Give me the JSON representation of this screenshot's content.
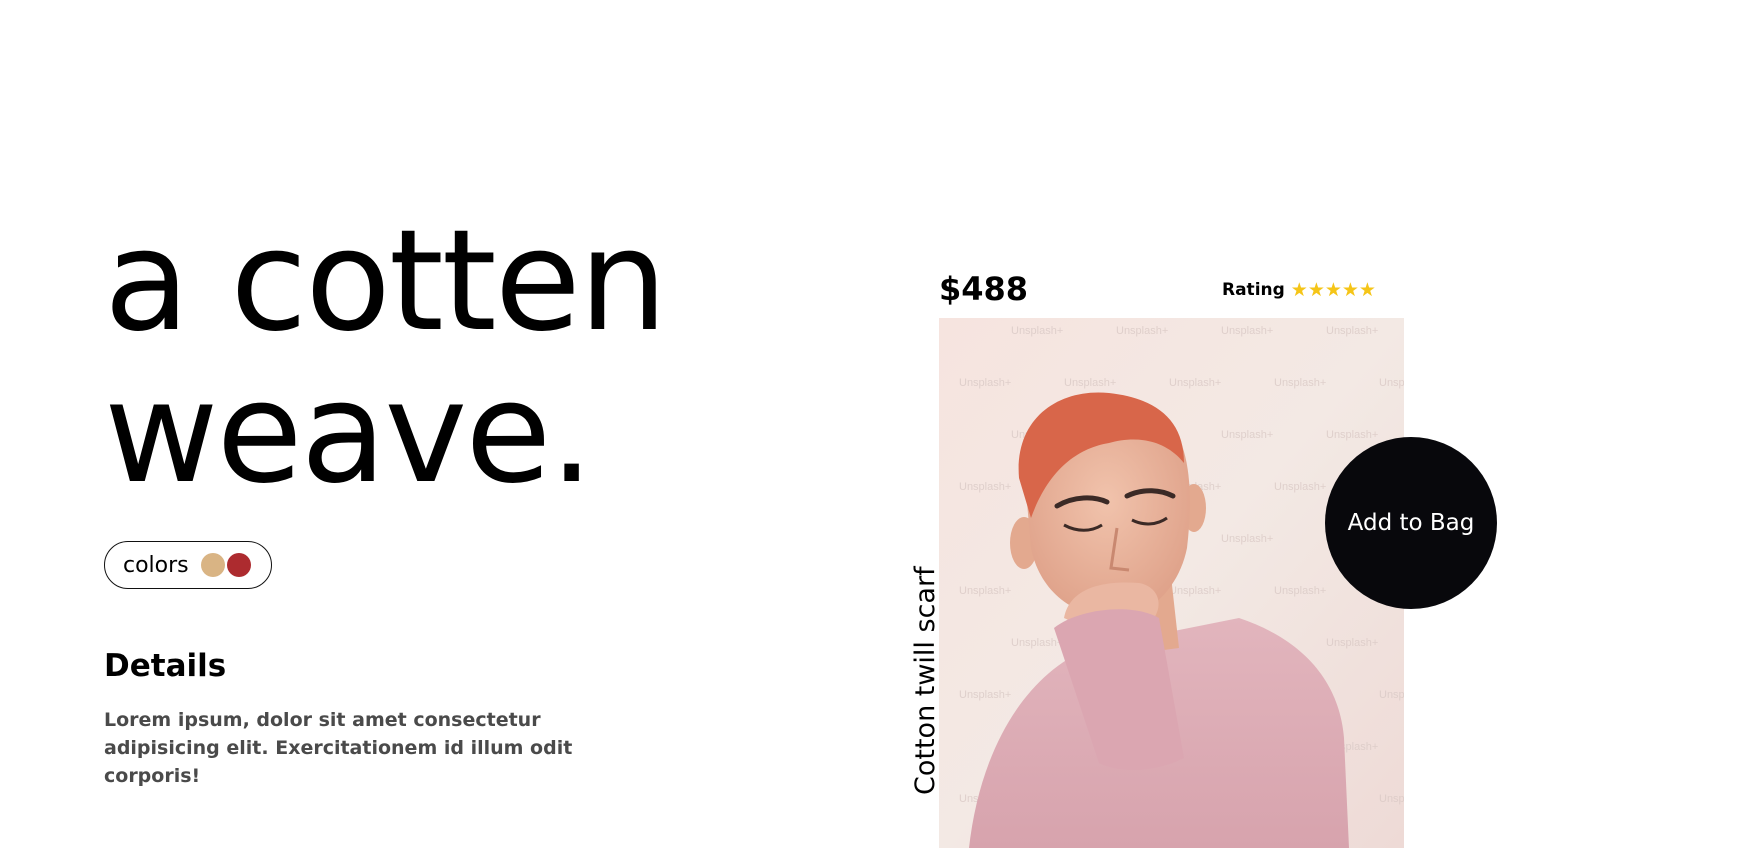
{
  "hero": {
    "line1": "a cotten",
    "line2": "weave."
  },
  "colors": {
    "label": "colors",
    "swatches": [
      {
        "name": "tan",
        "hex": "#d9b484"
      },
      {
        "name": "red",
        "hex": "#ad2b2f"
      }
    ]
  },
  "details": {
    "title": "Details",
    "text": "Lorem ipsum, dolor sit amet consectetur adipisicing elit. Exercitationem id illum odit corporis!"
  },
  "product": {
    "price": "$488",
    "rating_label": "Rating",
    "rating_stars": "★★★★★",
    "rating_value": 5,
    "name": "Cotton twill scarf",
    "watermark": "Unsplash+",
    "add_to_bag_label": "Add to Bag"
  },
  "theme": {
    "star_color": "#f5c518",
    "button_bg": "#08080c"
  }
}
